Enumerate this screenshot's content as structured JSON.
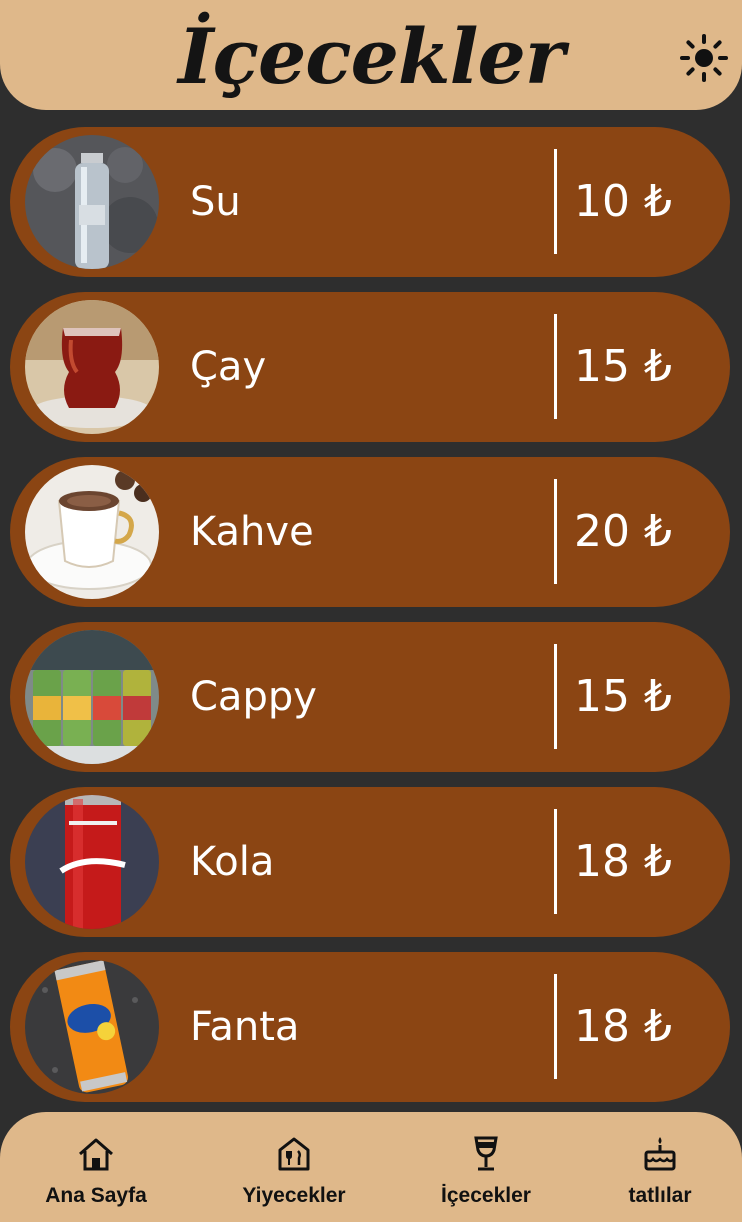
{
  "header": {
    "title": "İçecekler",
    "theme_icon": "sun-icon"
  },
  "colors": {
    "header_bg": "#dfb88a",
    "card_bg": "#8b4513",
    "page_bg": "#2e2e2e",
    "text_light": "#ffffff"
  },
  "items": [
    {
      "name": "Su",
      "price": "10 ₺",
      "image": "water-bottle-image"
    },
    {
      "name": "Çay",
      "price": "15 ₺",
      "image": "turkish-tea-image"
    },
    {
      "name": "Kahve",
      "price": "20 ₺",
      "image": "turkish-coffee-image"
    },
    {
      "name": "Cappy",
      "price": "15 ₺",
      "image": "cappy-cans-image"
    },
    {
      "name": "Kola",
      "price": "18 ₺",
      "image": "coca-cola-can-image"
    },
    {
      "name": "Fanta",
      "price": "18 ₺",
      "image": "fanta-can-image"
    }
  ],
  "nav": [
    {
      "label": "Ana Sayfa",
      "icon": "home-icon"
    },
    {
      "label": "Yiyecekler",
      "icon": "food-icon"
    },
    {
      "label": "İçecekler",
      "icon": "glass-icon"
    },
    {
      "label": "tatlılar",
      "icon": "cake-icon"
    }
  ]
}
